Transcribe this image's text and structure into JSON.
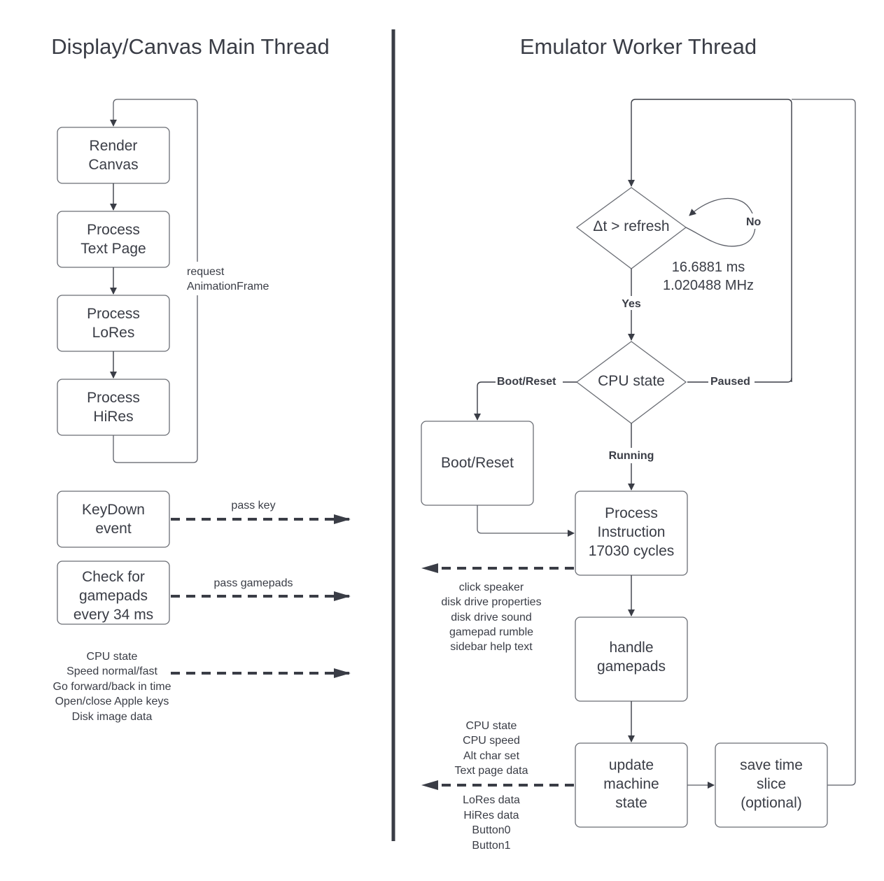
{
  "headings": {
    "left": "Display/Canvas Main Thread",
    "right": "Emulator Worker Thread"
  },
  "main_thread": {
    "loop_boxes": [
      {
        "lines": [
          "Render",
          "Canvas"
        ]
      },
      {
        "lines": [
          "Process",
          "Text Page"
        ]
      },
      {
        "lines": [
          "Process",
          "LoRes"
        ]
      },
      {
        "lines": [
          "Process",
          "HiRes"
        ]
      }
    ],
    "loop_label": [
      "request",
      "AnimationFrame"
    ],
    "keydown_box": {
      "lines": [
        "KeyDown",
        "event"
      ]
    },
    "keydown_arrow_label": "pass key",
    "gamepad_box": {
      "lines": [
        "Check for",
        "gamepads",
        "every 34 ms"
      ]
    },
    "gamepad_arrow_label": "pass gamepads",
    "misc_messages": [
      "CPU state",
      "Speed normal/fast",
      "Go forward/back in time",
      "Open/close Apple keys",
      "Disk image data"
    ]
  },
  "worker_thread": {
    "refresh_decision": {
      "text": "Δt > refresh",
      "no_label": "No",
      "yes_label": "Yes"
    },
    "refresh_note": [
      "16.6881 ms",
      "1.020488 MHz"
    ],
    "cpu_state_decision": {
      "text": "CPU state",
      "boot_label": "Boot/Reset",
      "paused_label": "Paused",
      "running_label": "Running"
    },
    "boot_box": {
      "lines": [
        "Boot/Reset"
      ]
    },
    "process_box": {
      "lines": [
        "Process",
        "Instruction",
        "17030 cycles"
      ]
    },
    "process_messages": [
      "click speaker",
      "disk drive properties",
      "disk drive sound",
      "gamepad rumble",
      "sidebar help text"
    ],
    "gamepads_box": {
      "lines": [
        "handle",
        "gamepads"
      ]
    },
    "update_box": {
      "lines": [
        "update",
        "machine",
        "state"
      ]
    },
    "update_messages_above": [
      "CPU state",
      "CPU speed",
      "Alt char set",
      "Text page data"
    ],
    "update_messages_below": [
      "LoRes data",
      "HiRes data",
      "Button0",
      "Button1"
    ],
    "save_box": {
      "lines": [
        "save time",
        "slice",
        "(optional)"
      ]
    }
  }
}
